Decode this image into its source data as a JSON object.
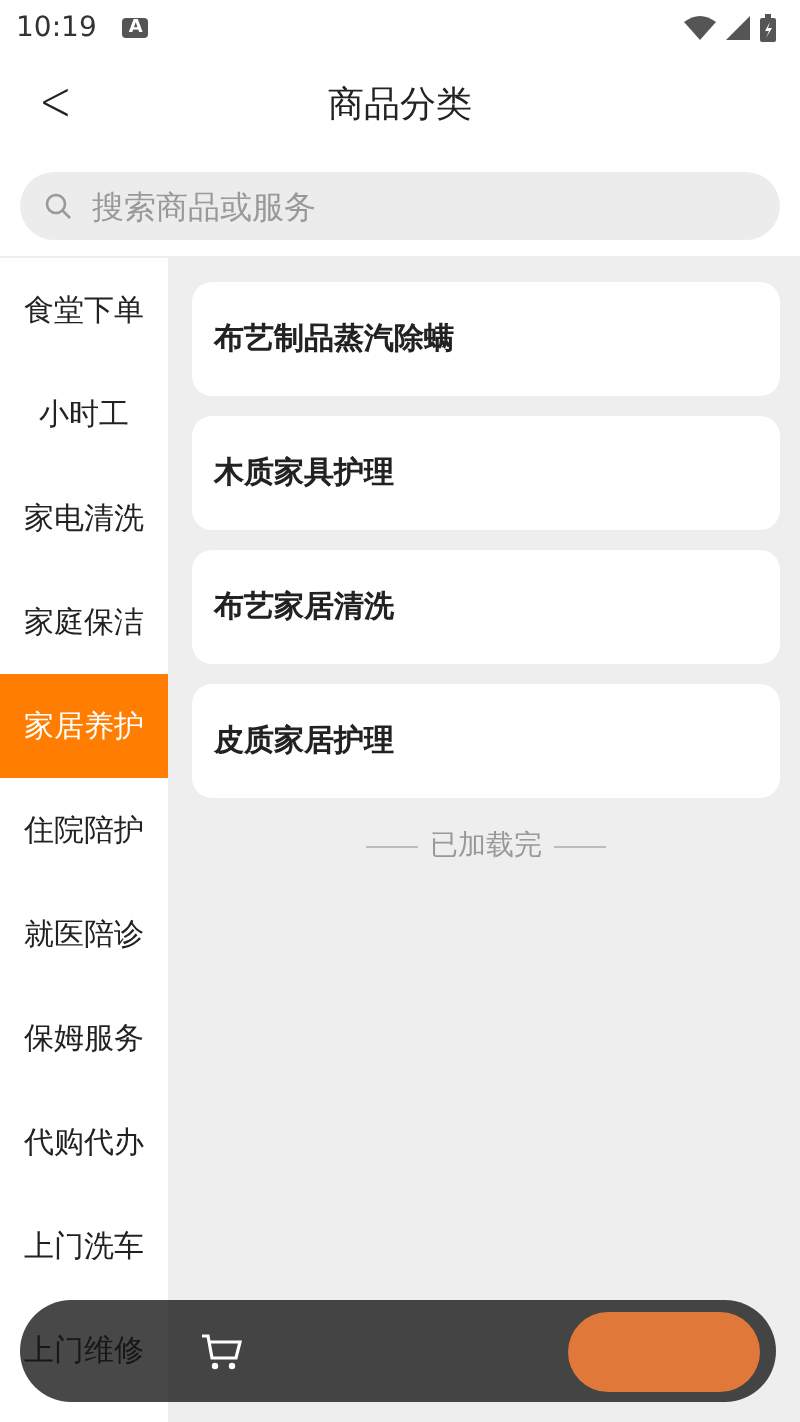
{
  "status_bar": {
    "time": "10:19",
    "badge": "A"
  },
  "header": {
    "back": "<",
    "title": "商品分类"
  },
  "search": {
    "placeholder": "搜索商品或服务"
  },
  "categories": [
    {
      "label": "食堂下单",
      "selected": false
    },
    {
      "label": "小时工",
      "selected": false
    },
    {
      "label": "家电清洗",
      "selected": false
    },
    {
      "label": "家庭保洁",
      "selected": false
    },
    {
      "label": "家居养护",
      "selected": true
    },
    {
      "label": "住院陪护",
      "selected": false
    },
    {
      "label": "就医陪诊",
      "selected": false
    },
    {
      "label": "保姆服务",
      "selected": false
    },
    {
      "label": "代购代办",
      "selected": false
    },
    {
      "label": "上门洗车",
      "selected": false
    },
    {
      "label": "上门维修",
      "selected": false
    }
  ],
  "products": [
    {
      "name": "布艺制品蒸汽除螨"
    },
    {
      "name": "木质家具护理"
    },
    {
      "name": "布艺家居清洗"
    },
    {
      "name": "皮质家居护理"
    }
  ],
  "end_note": "已加载完"
}
